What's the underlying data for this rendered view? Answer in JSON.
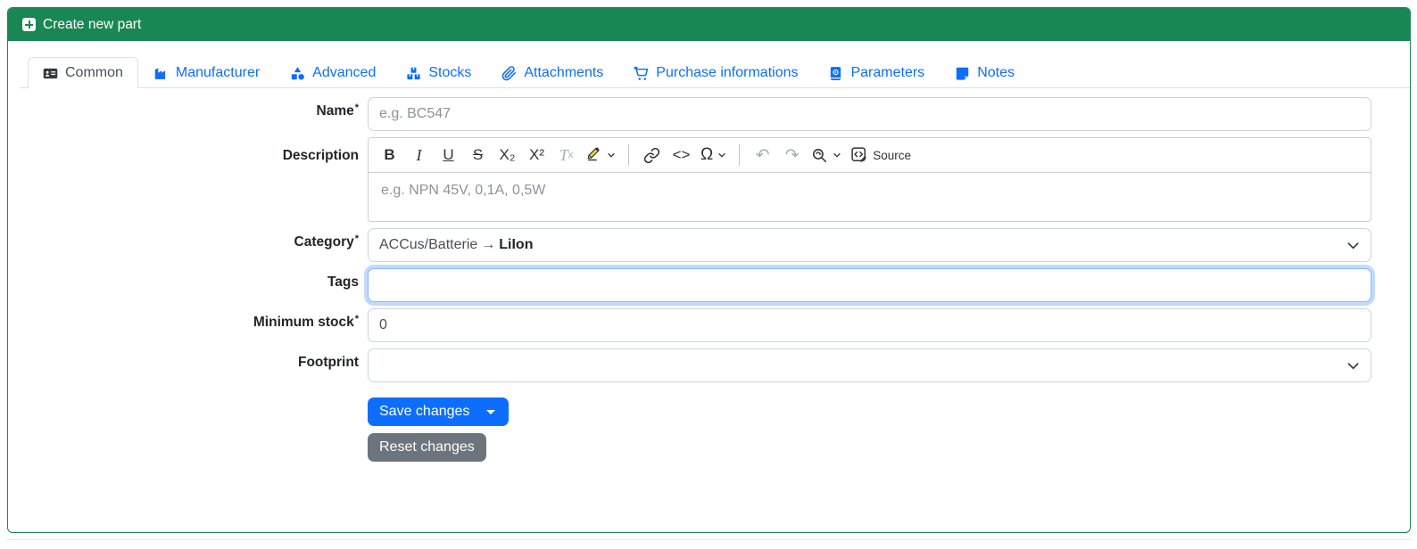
{
  "header": {
    "title": "Create new part",
    "icon": "plus-square-icon"
  },
  "tabs": [
    {
      "label": "Common",
      "icon": "id-card-icon",
      "active": true
    },
    {
      "label": "Manufacturer",
      "icon": "factory-icon",
      "active": false
    },
    {
      "label": "Advanced",
      "icon": "shapes-icon",
      "active": false
    },
    {
      "label": "Stocks",
      "icon": "boxes-icon",
      "active": false
    },
    {
      "label": "Attachments",
      "icon": "paperclip-icon",
      "active": false
    },
    {
      "label": "Purchase informations",
      "icon": "shopping-cart-icon",
      "active": false
    },
    {
      "label": "Parameters",
      "icon": "book-icon",
      "active": false
    },
    {
      "label": "Notes",
      "icon": "sticky-note-icon",
      "active": false
    }
  ],
  "required_mark": "*",
  "form": {
    "name": {
      "label": "Name",
      "required": true,
      "placeholder": "e.g. BC547",
      "value": ""
    },
    "description": {
      "label": "Description",
      "placeholder": "e.g. NPN 45V, 0,1A, 0,5W",
      "toolbar": {
        "bold": "B",
        "italic": "I",
        "underline": "U",
        "strikethrough": "S",
        "subscript": "X₂",
        "superscript": "X²",
        "remove_format_main": "T",
        "remove_format_sub": "x",
        "code": "<>",
        "special_characters": "Ω",
        "undo": "↶",
        "redo": "↷",
        "source_label": "Source"
      }
    },
    "category": {
      "label": "Category",
      "required": true,
      "value_parent": "ACCus/Batterie",
      "arrow": "→",
      "value_child": "LiIon"
    },
    "tags": {
      "label": "Tags",
      "value": "",
      "focused": true
    },
    "minimum_stock": {
      "label": "Minimum stock",
      "required": true,
      "value": "0"
    },
    "footprint": {
      "label": "Footprint",
      "value": ""
    }
  },
  "actions": {
    "save": {
      "label": "Save changes"
    },
    "reset": {
      "label": "Reset changes"
    }
  },
  "colors": {
    "header_green": "#198754",
    "primary_blue": "#0d6efd",
    "secondary_gray": "#6c757d",
    "tab_border": "#dee2e6",
    "input_border": "#ced4da",
    "focus_ring": "#86b7fe",
    "highlight_yellow": "#f5d423"
  }
}
